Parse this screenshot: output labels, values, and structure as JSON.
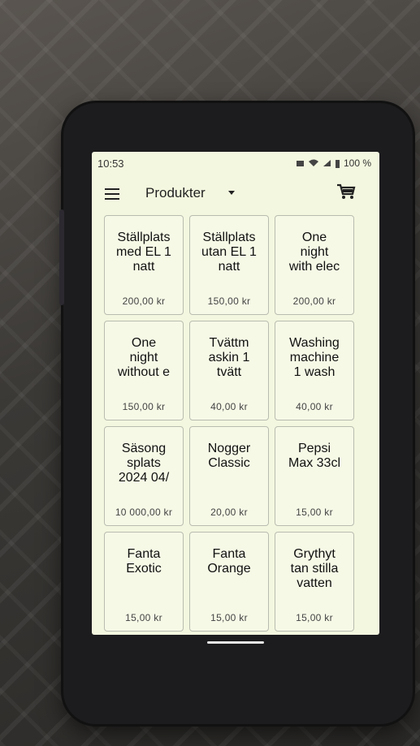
{
  "status": {
    "time": "10:53",
    "battery": "100 %"
  },
  "header": {
    "title": "Produkter"
  },
  "products": [
    {
      "name": "Ställplats\nmed EL 1\nnatt",
      "price": "200,00 kr"
    },
    {
      "name": "Ställplats\nutan EL 1\nnatt",
      "price": "150,00 kr"
    },
    {
      "name": "One\nnight\nwith elec",
      "price": "200,00 kr"
    },
    {
      "name": "One\nnight\nwithout e",
      "price": "150,00 kr"
    },
    {
      "name": "Tvättm\naskin 1\ntvätt",
      "price": "40,00 kr"
    },
    {
      "name": "Washing\nmachine\n1 wash",
      "price": "40,00 kr"
    },
    {
      "name": "Säsong\nsplats\n2024 04/",
      "price": "10 000,00 kr"
    },
    {
      "name": "Nogger\nClassic",
      "price": "20,00 kr"
    },
    {
      "name": "Pepsi\nMax 33cl",
      "price": "15,00 kr"
    },
    {
      "name": "Fanta\nExotic",
      "price": "15,00 kr"
    },
    {
      "name": "Fanta\nOrange",
      "price": "15,00 kr"
    },
    {
      "name": "Grythyt\ntan stilla\nvatten",
      "price": "15,00 kr"
    }
  ]
}
